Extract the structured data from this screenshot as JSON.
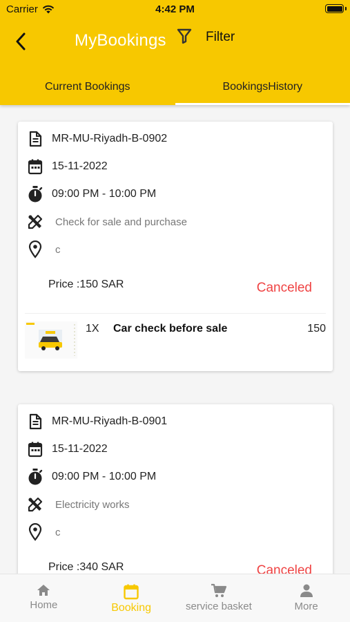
{
  "status_bar": {
    "carrier": "Carrier",
    "time": "4:42 PM"
  },
  "header": {
    "title": "MyBookings",
    "filter_label": "Filter",
    "accent": "#f7c800"
  },
  "tabs": [
    {
      "label": "Current Bookings",
      "active": true
    },
    {
      "label": "BookingsHistory",
      "active": false
    }
  ],
  "bookings": [
    {
      "code": "MR-MU-Riyadh-B-0902",
      "date": "15-11-2022",
      "time": "09:00 PM - 10:00 PM",
      "service": "Check for sale and purchase",
      "location": "c",
      "price": "Price :150 SAR",
      "status": "Canceled",
      "item": {
        "qty": "1X",
        "name": "Car check before sale",
        "price": "150"
      }
    },
    {
      "code": "MR-MU-Riyadh-B-0901",
      "date": "15-11-2022",
      "time": "09:00 PM - 10:00 PM",
      "service": "Electricity works",
      "location": "c",
      "price": "Price :340 SAR",
      "status": "Canceled"
    }
  ],
  "bottom_nav": [
    {
      "label": "Home",
      "icon": "home-icon",
      "active": false
    },
    {
      "label": "Booking",
      "icon": "calendar-icon",
      "active": true
    },
    {
      "label": "service basket",
      "icon": "cart-icon",
      "active": false
    },
    {
      "label": "More",
      "icon": "person-icon",
      "active": false
    }
  ],
  "colors": {
    "status_canceled": "#ef4343",
    "nav_active": "#f7c800",
    "nav_inactive": "#8a8a8a"
  }
}
